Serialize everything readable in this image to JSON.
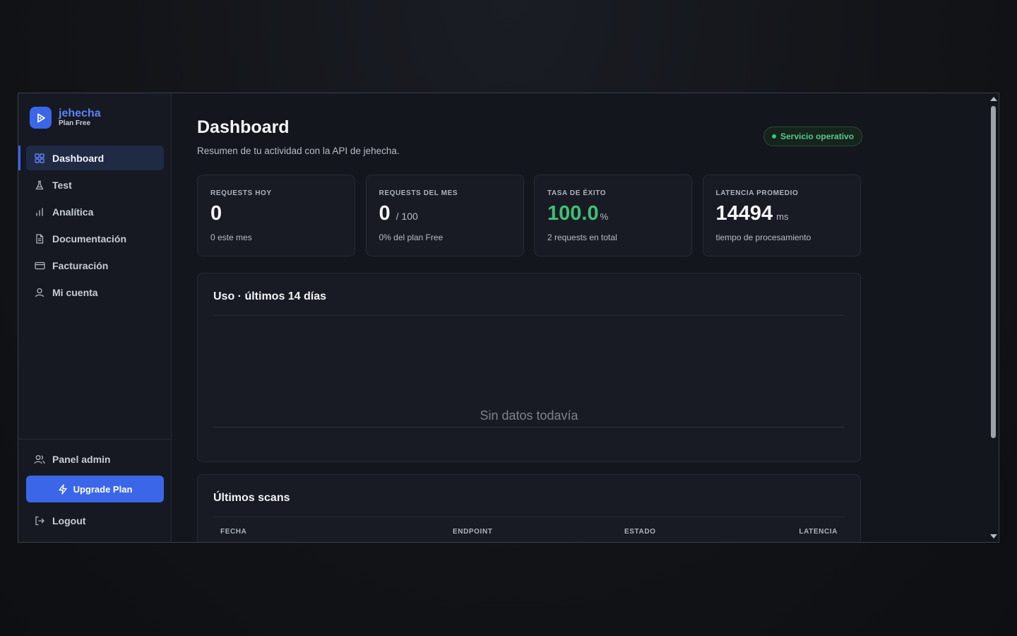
{
  "brand": {
    "name": "jehecha",
    "plan": "Plan Free"
  },
  "sidebar": {
    "items": [
      {
        "label": "Dashboard",
        "icon": "grid-icon",
        "active": true
      },
      {
        "label": "Test",
        "icon": "flask-icon",
        "active": false
      },
      {
        "label": "Analítica",
        "icon": "bar-chart-icon",
        "active": false
      },
      {
        "label": "Documentación",
        "icon": "document-icon",
        "active": false
      },
      {
        "label": "Facturación",
        "icon": "credit-card-icon",
        "active": false
      },
      {
        "label": "Mi cuenta",
        "icon": "user-icon",
        "active": false
      }
    ],
    "admin_label": "Panel admin",
    "upgrade_label": "Upgrade Plan",
    "logout_label": "Logout"
  },
  "header": {
    "title": "Dashboard",
    "subtitle": "Resumen de tu actividad con la API de jehecha.",
    "status": "Servicio operativo"
  },
  "stats": [
    {
      "label": "REQUESTS HOY",
      "value": "0",
      "suffix": "",
      "sub": "0 este mes"
    },
    {
      "label": "REQUESTS DEL MES",
      "value": "0",
      "suffix": "/ 100",
      "sub": "0% del plan Free"
    },
    {
      "label": "TASA DE ÉXITO",
      "value": "100.0",
      "suffix": "%",
      "sub": "2 requests en total"
    },
    {
      "label": "LATENCIA PROMEDIO",
      "value": "14494",
      "suffix": "ms",
      "sub": "tiempo de procesamiento"
    }
  ],
  "usage": {
    "title": "Uso · últimos 14 días",
    "empty": "Sin datos todavía"
  },
  "scans": {
    "title": "Últimos scans",
    "columns": [
      "FECHA",
      "ENDPOINT",
      "ESTADO",
      "LATENCIA"
    ]
  },
  "colors": {
    "accent": "#3b66e8",
    "success": "#3fbf76",
    "background": "#13161c"
  }
}
